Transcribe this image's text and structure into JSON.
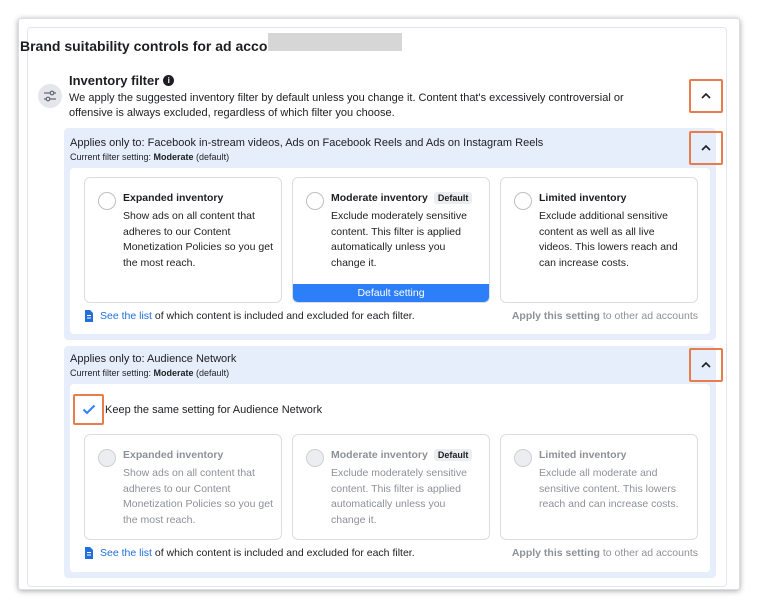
{
  "header": {
    "title": "Brand suitability controls for ad account:"
  },
  "inventory_filter": {
    "title": "Inventory filter",
    "info_icon": "i",
    "description": "We apply the suggested inventory filter by default unless you change it. Content that's excessively controversial or offensive is always excluded, regardless of which filter you choose."
  },
  "section1": {
    "title": "Applies only to: Facebook in-stream videos, Ads on Facebook Reels and Ads on Instagram Reels",
    "current_prefix": "Current filter setting: ",
    "current_value": "Moderate",
    "current_suffix": " (default)",
    "cards": [
      {
        "title": "Expanded inventory",
        "desc": "Show ads on all content that adheres to our Content Monetization Policies so you get the most reach."
      },
      {
        "title": "Moderate inventory",
        "badge": "Default",
        "desc": "Exclude moderately sensitive content. This filter is applied automatically unless you change it.",
        "footer": "Default setting"
      },
      {
        "title": "Limited inventory",
        "desc": "Exclude additional sensitive content as well as all live videos. This lowers reach and can increase costs."
      }
    ],
    "see_list_link": "See the list",
    "see_list_rest": " of which content is included and excluded for each filter.",
    "apply_bold": "Apply this setting",
    "apply_rest": " to other ad accounts"
  },
  "section2": {
    "title": "Applies only to: Audience Network",
    "current_prefix": "Current filter setting: ",
    "current_value": "Moderate",
    "current_suffix": " (default)",
    "keep_same_label": "Keep the same setting for Audience Network",
    "cards": [
      {
        "title": "Expanded inventory",
        "desc": "Show ads on all content that adheres to our Content Monetization Policies so you get the most reach."
      },
      {
        "title": "Moderate inventory",
        "badge": "Default",
        "desc": "Exclude moderately sensitive content. This filter is applied automatically unless you change it."
      },
      {
        "title": "Limited inventory",
        "desc": "Exclude all moderate and sensitive content. This lowers reach and can increase costs."
      }
    ],
    "see_list_link": "See the list",
    "see_list_rest": " of which content is included and excluded for each filter.",
    "apply_bold": "Apply this setting",
    "apply_rest": " to other ad accounts"
  },
  "colors": {
    "accent_blue": "#2d7ff9",
    "link_blue": "#216fdb",
    "highlight_orange": "#e97c4b",
    "section_bg": "#e7eefb"
  }
}
